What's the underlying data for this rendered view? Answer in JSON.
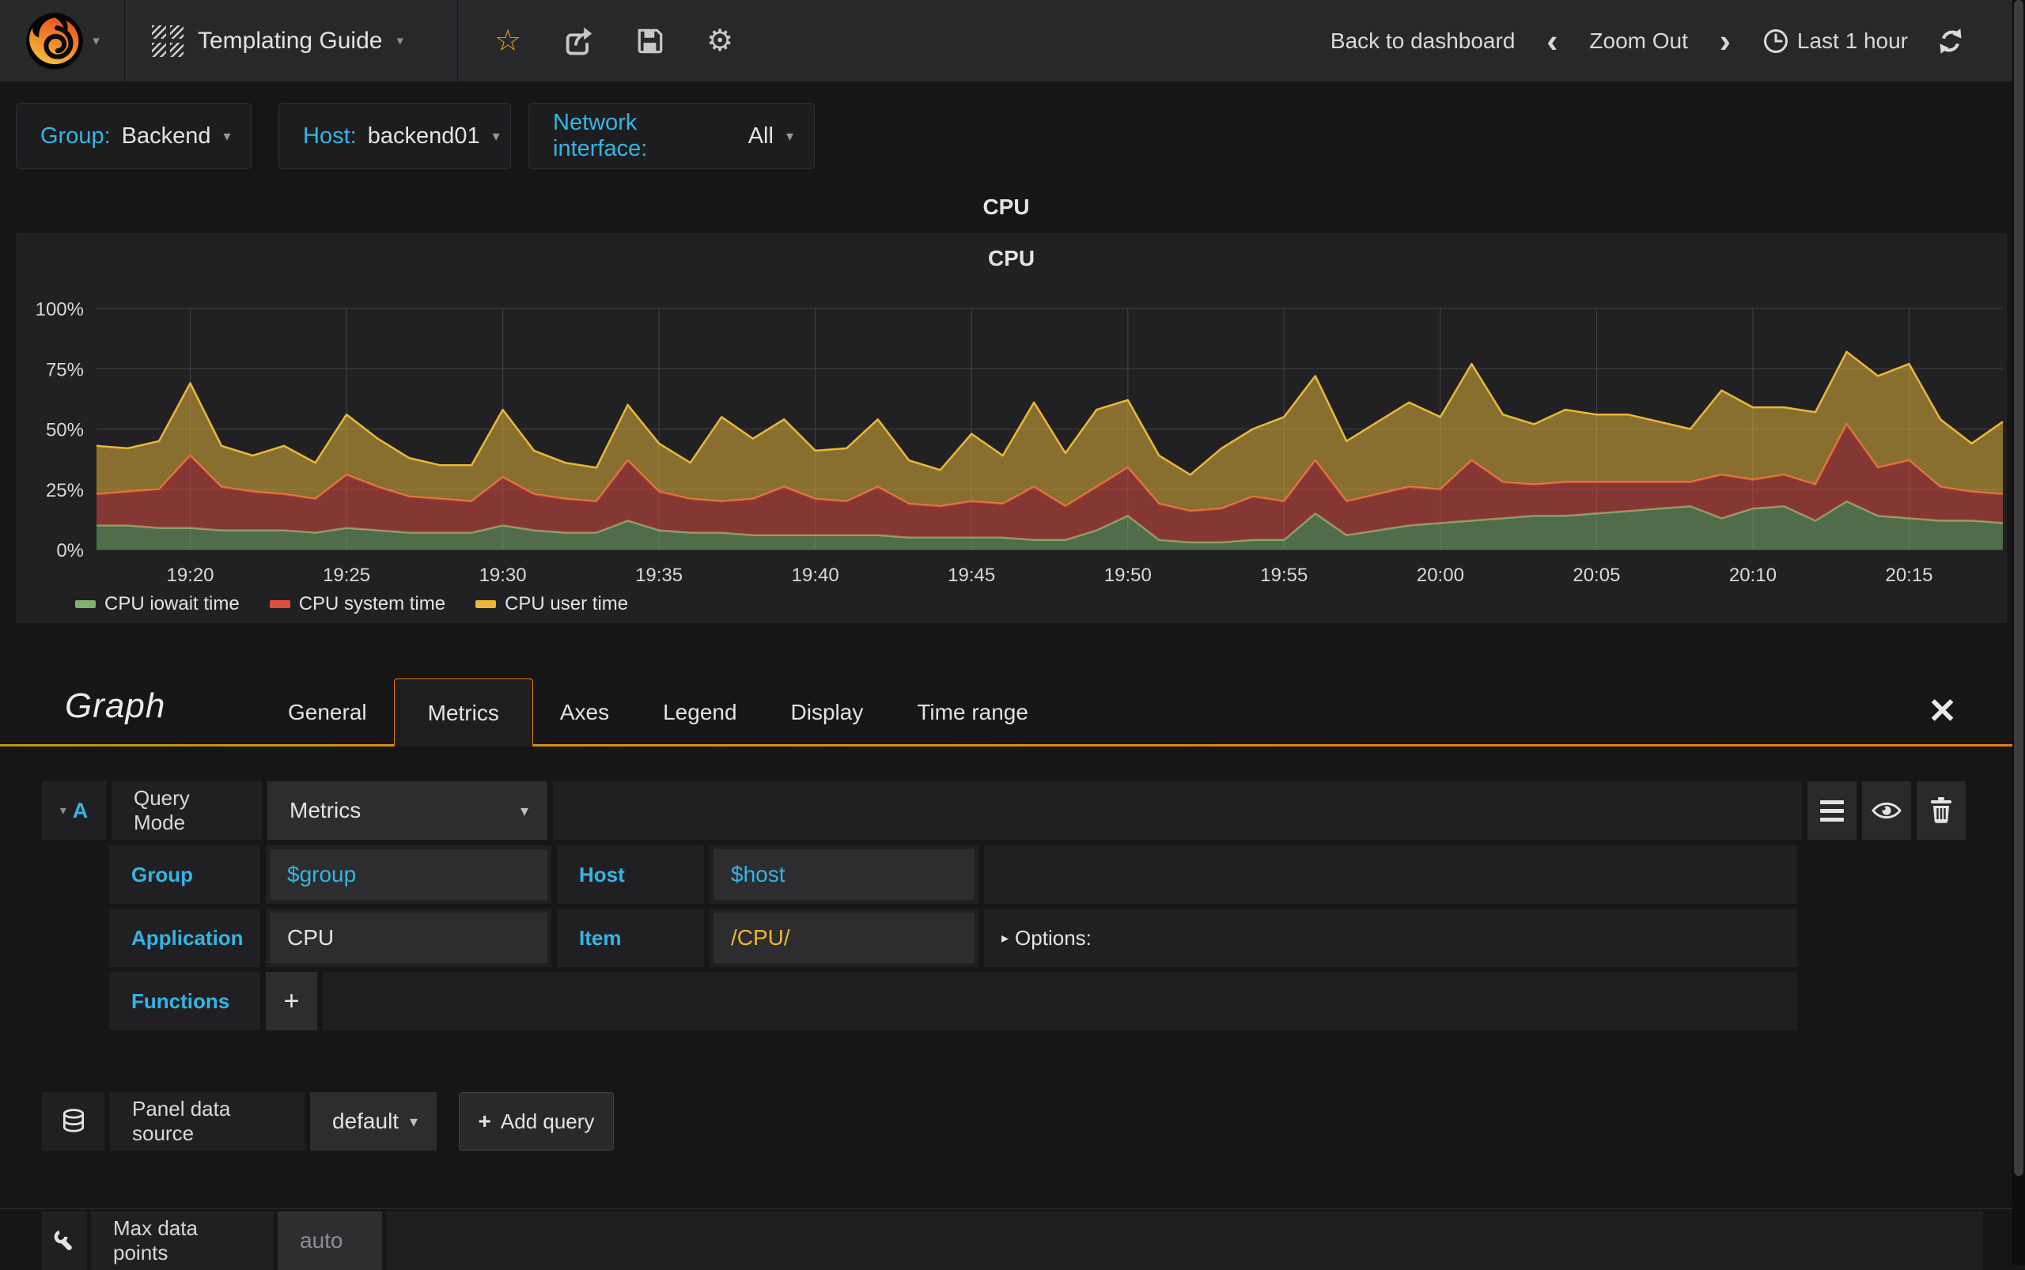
{
  "navbar": {
    "title": "Templating Guide",
    "back_to_dashboard": "Back to dashboard",
    "zoom_out": "Zoom Out",
    "time_range": "Last 1 hour",
    "chevron_left": "‹",
    "chevron_right": "›",
    "star_icon": "☆",
    "gear_icon": "⚙",
    "caret": "▾"
  },
  "template_vars": [
    {
      "label": "Group:",
      "value": "Backend"
    },
    {
      "label": "Host:",
      "value": "backend01"
    },
    {
      "label": "Network interface:",
      "value": "All"
    }
  ],
  "panel": {
    "header_title": "CPU",
    "inner_title": "CPU"
  },
  "chart_data": {
    "type": "area",
    "stacked": true,
    "title": "CPU",
    "xlabel": "",
    "ylabel": "",
    "ylim": [
      0,
      100
    ],
    "grid": true,
    "legend_position": "bottom-left",
    "x_range": [
      "19:17",
      "20:18"
    ],
    "x_ticks": [
      "19:20",
      "19:25",
      "19:30",
      "19:35",
      "19:40",
      "19:45",
      "19:50",
      "19:55",
      "20:00",
      "20:05",
      "20:10",
      "20:15"
    ],
    "x_tick_indices": [
      3,
      8,
      13,
      18,
      23,
      28,
      33,
      38,
      43,
      48,
      53,
      58
    ],
    "y_ticks": [
      "0%",
      "25%",
      "50%",
      "75%",
      "100%"
    ],
    "y_tick_values": [
      0,
      25,
      50,
      75,
      100
    ],
    "series": [
      {
        "name": "CPU iowait time",
        "color": "#7eb26d",
        "values": [
          10,
          10,
          9,
          9,
          8,
          8,
          8,
          7,
          9,
          8,
          7,
          7,
          7,
          10,
          8,
          7,
          7,
          12,
          8,
          7,
          7,
          6,
          6,
          6,
          6,
          6,
          5,
          5,
          5,
          5,
          4,
          4,
          8,
          14,
          4,
          3,
          3,
          4,
          4,
          15,
          6,
          8,
          10,
          11,
          12,
          13,
          14,
          14,
          15,
          16,
          17,
          18,
          13,
          17,
          18,
          12,
          20,
          14,
          13,
          12,
          12,
          11
        ]
      },
      {
        "name": "CPU system time",
        "color": "#e24d42",
        "values": [
          13,
          14,
          16,
          30,
          18,
          16,
          15,
          14,
          22,
          18,
          15,
          14,
          13,
          20,
          15,
          14,
          13,
          25,
          16,
          14,
          13,
          15,
          20,
          15,
          14,
          20,
          14,
          13,
          15,
          14,
          22,
          14,
          18,
          20,
          15,
          13,
          14,
          18,
          16,
          22,
          14,
          15,
          16,
          14,
          25,
          15,
          13,
          14,
          13,
          12,
          11,
          10,
          18,
          12,
          13,
          15,
          32,
          20,
          24,
          14,
          12,
          12
        ]
      },
      {
        "name": "CPU user time",
        "color": "#eab839",
        "values": [
          20,
          18,
          20,
          30,
          17,
          15,
          20,
          15,
          25,
          20,
          16,
          14,
          15,
          28,
          18,
          15,
          14,
          23,
          20,
          15,
          35,
          25,
          28,
          20,
          22,
          28,
          18,
          15,
          28,
          20,
          35,
          22,
          32,
          28,
          20,
          15,
          25,
          28,
          35,
          35,
          25,
          30,
          35,
          30,
          40,
          28,
          25,
          30,
          28,
          28,
          25,
          22,
          35,
          30,
          28,
          30,
          30,
          38,
          40,
          28,
          20,
          30
        ]
      }
    ]
  },
  "editor": {
    "panel_type_label": "Graph",
    "close": "✕",
    "tabs": [
      {
        "label": "General",
        "active": false
      },
      {
        "label": "Metrics",
        "active": true
      },
      {
        "label": "Axes",
        "active": false
      },
      {
        "label": "Legend",
        "active": false
      },
      {
        "label": "Display",
        "active": false
      },
      {
        "label": "Time range",
        "active": false
      }
    ],
    "query": {
      "letter": "A",
      "collapse_caret": "▾",
      "query_mode": {
        "label": "Query Mode",
        "value": "Metrics"
      },
      "group": {
        "label": "Group",
        "value": "$group"
      },
      "host": {
        "label": "Host",
        "value": "$host"
      },
      "application": {
        "label": "Application",
        "value": "CPU"
      },
      "item": {
        "label": "Item",
        "value": "/CPU/"
      },
      "options_label": "Options:",
      "options_chevron": "▸",
      "functions": {
        "label": "Functions",
        "add": "+"
      }
    },
    "datasource": {
      "label": "Panel data source",
      "value": "default",
      "caret": "▾",
      "add_query_plus": "+",
      "add_query_label": "Add query"
    },
    "max_data_points": {
      "label": "Max data points",
      "placeholder": "auto"
    }
  },
  "colors": {
    "accent_cyan": "#33b5e5",
    "accent_orange": "#e87a12",
    "item_regex_yellow": "#eab839",
    "green": "#7eb26d",
    "red": "#e24d42",
    "yellow": "#eab839"
  }
}
